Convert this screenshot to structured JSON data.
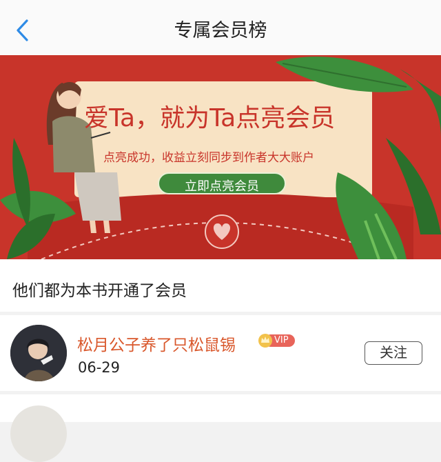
{
  "header": {
    "title": "专属会员榜",
    "back_icon": "chevron-left-icon"
  },
  "banner": {
    "headline": "爱Ta，就为Ta点亮会员",
    "subline": "点亮成功，收益立刻同步到作者大大账户",
    "cta_label": "立即点亮会员",
    "colors": {
      "background": "#c8342a",
      "card": "#f8e3c4",
      "headline": "#c8342a",
      "cta": "#3f8a3c"
    }
  },
  "section": {
    "title": "他们都为本书开通了会员"
  },
  "members": [
    {
      "name": "松月公子养了只松鼠锡",
      "badge": "VIP",
      "date": "06-29",
      "follow_label": "关注"
    }
  ],
  "theme": {
    "accent": "#2e8be6",
    "name_color": "#d9572b"
  }
}
